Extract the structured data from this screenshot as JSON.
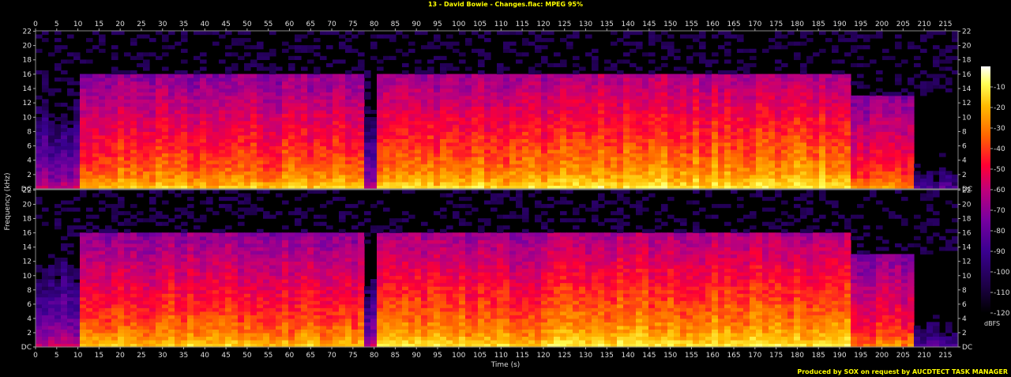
{
  "chart_data": {
    "type": "heatmap",
    "title": "13 - David Bowie - Changes.flac: MPEG 95%",
    "xlabel": "Time (s)",
    "ylabel": "Frequency (kHz)",
    "colorbar_label": "dBFS",
    "credit": "Produced by SOX on request by AUCDTECT TASK MANAGER",
    "xlim": [
      0,
      218
    ],
    "x_ticks": [
      0,
      5,
      10,
      15,
      20,
      25,
      30,
      35,
      40,
      45,
      50,
      55,
      60,
      65,
      70,
      75,
      80,
      85,
      90,
      95,
      100,
      105,
      110,
      115,
      120,
      125,
      130,
      135,
      140,
      145,
      150,
      155,
      160,
      165,
      170,
      175,
      180,
      185,
      190,
      195,
      200,
      205,
      210,
      215
    ],
    "ylim": [
      0,
      22.05
    ],
    "y_tick_labels": [
      "DC",
      "2",
      "4",
      "6",
      "8",
      "10",
      "12",
      "14",
      "16",
      "18",
      "20",
      "22"
    ],
    "y_tick_values": [
      0,
      2,
      4,
      6,
      8,
      10,
      12,
      14,
      16,
      18,
      20,
      22
    ],
    "channels": 2,
    "colorbar_ticks": [
      -10,
      -20,
      -30,
      -40,
      -50,
      -60,
      -70,
      -80,
      -90,
      -100,
      -110,
      -120
    ],
    "colorbar_range": [
      -120,
      0
    ],
    "colormap": [
      "#000000",
      "#1a0040",
      "#3a0090",
      "#7800a0",
      "#c0007a",
      "#ff0033",
      "#ff6600",
      "#ffbb00",
      "#ffff55",
      "#ffffff"
    ],
    "cutoff_khz_segments": [
      {
        "start": 0,
        "end": 10,
        "cutoff_khz": 13.2
      },
      {
        "start": 10,
        "end": 78,
        "cutoff_khz": 16.0
      },
      {
        "start": 78,
        "end": 81,
        "cutoff_khz": 13.2
      },
      {
        "start": 81,
        "end": 122,
        "cutoff_khz": 16.0
      },
      {
        "start": 122,
        "end": 193,
        "cutoff_khz": 16.0
      },
      {
        "start": 193,
        "end": 218,
        "cutoff_khz": 13.2
      }
    ],
    "loud_sections": [
      {
        "start": 10,
        "end": 78,
        "level_db": -35
      },
      {
        "start": 81,
        "end": 122,
        "level_db": -32
      },
      {
        "start": 123,
        "end": 193,
        "level_db": -28
      },
      {
        "start": 193,
        "end": 208,
        "level_db": -45
      }
    ],
    "quiet_sections": [
      {
        "start": 0,
        "end": 10,
        "level_db": -75
      },
      {
        "start": 78,
        "end": 81,
        "level_db": -80
      },
      {
        "start": 208,
        "end": 218,
        "level_db": -100
      }
    ]
  }
}
